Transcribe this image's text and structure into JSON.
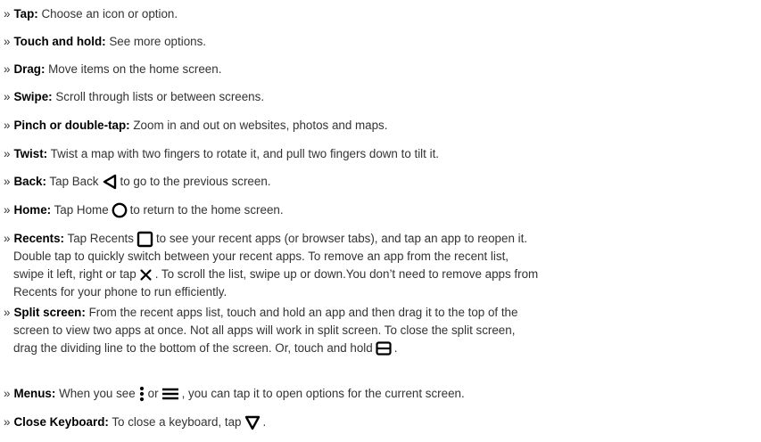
{
  "bullet": "»",
  "items": [
    {
      "term": "Tap:",
      "text": "Choose an icon or option."
    },
    {
      "term": "Touch and hold:",
      "text": "See more options."
    },
    {
      "term": "Drag:",
      "text": "Move items on the home screen."
    },
    {
      "term": "Swipe:",
      "text": "Scroll through lists or between screens."
    },
    {
      "term": "Pinch or double-tap:",
      "text": "Zoom in and out on websites, photos and maps."
    },
    {
      "term": "Twist:",
      "text": "Twist a map with two fingers to rotate it, and pull two fingers down to tilt it."
    },
    {
      "term": "Back:",
      "text_a": "Tap Back",
      "text_b": "to go to the previous screen.",
      "icon": "back-triangle-icon"
    },
    {
      "term": "Home:",
      "text_a": "Tap Home",
      "text_b": "to return to the home screen.",
      "icon": "home-circle-icon"
    },
    {
      "term": "Recents:",
      "text_a": "Tap Recents",
      "text_b": "to see your recent apps (or browser tabs), and tap an app to reopen it.",
      "line2": "Double tap to quickly switch between your recent apps. To remove an app from the recent list,",
      "line3a": "swipe it left, right or tap",
      "line3b": ". To scroll the list, swipe up or down.You don’t need to remove apps from",
      "line4": "Recents for your phone to run efficiently.",
      "icon": "recents-square-icon",
      "icon2": "close-x-icon"
    },
    {
      "term": "Split screen:",
      "text": "From the recent apps list, touch and hold an app and then drag it to the top of the",
      "line2": "screen to view two apps at once. Not all apps will work in split screen. To close the split screen,",
      "line3": "drag the dividing line to the bottom of the screen. Or, touch and hold",
      "line3_end": ".",
      "icon": "split-screen-icon"
    },
    {
      "term": "Menus:",
      "text_a": "When you see",
      "text_or": "or",
      "text_b": ", you can tap it to open options for the current screen.",
      "icon": "more-vertical-icon",
      "icon2": "menu-lines-icon"
    },
    {
      "term": "Close Keyboard:",
      "text_a": "To close a keyboard, tap",
      "text_b": ".",
      "icon": "close-keyboard-icon"
    }
  ]
}
